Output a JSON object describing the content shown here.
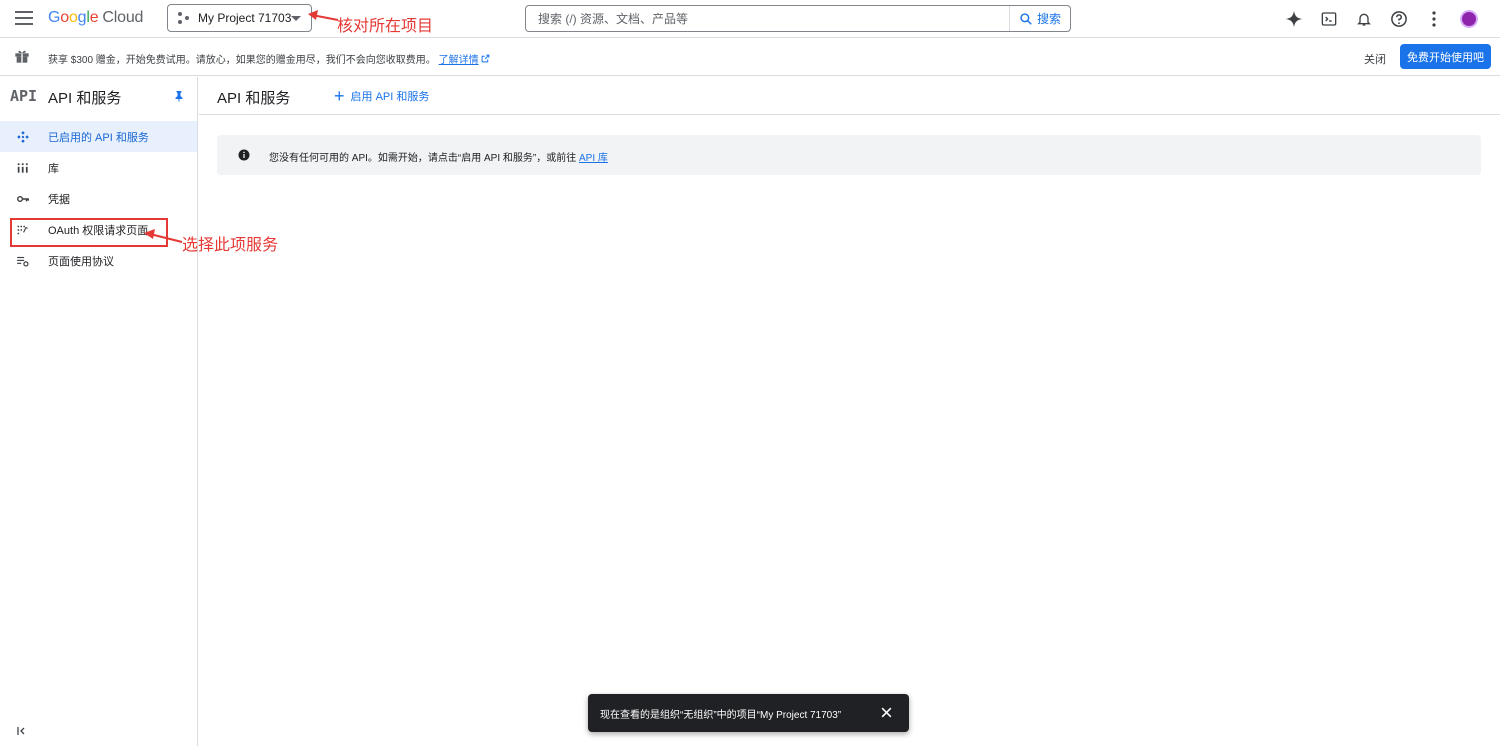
{
  "header": {
    "logo_google": [
      "G",
      "o",
      "o",
      "g",
      "l",
      "e"
    ],
    "logo_cloud": "Cloud",
    "project_name": "My Project 71703",
    "search_placeholder": "搜索 (/) 资源、文档、产品等",
    "search_button": "搜索",
    "icons": [
      "gemini-icon",
      "cloud-shell-icon",
      "notifications-icon",
      "help-icon",
      "more-vert-icon",
      "avatar"
    ]
  },
  "annotations": {
    "project_note": "核对所在项目",
    "oauth_note": "选择此项服务",
    "color": "#e53935"
  },
  "promo": {
    "text": "获享 $300 赠金，开始免费试用。请放心，如果您的赠金用尽，我们不会向您收取费用。",
    "link": "了解详情",
    "close": "关闭",
    "cta": "免费开始使用吧"
  },
  "sidebar": {
    "logo_text": "API",
    "title": "API 和服务",
    "items": [
      {
        "label": "已启用的 API 和服务",
        "icon": "api-hub-icon",
        "active": true
      },
      {
        "label": "库",
        "icon": "library-icon",
        "active": false
      },
      {
        "label": "凭据",
        "icon": "key-icon",
        "active": false
      },
      {
        "label": "OAuth 权限请求页面",
        "icon": "oauth-consent-icon",
        "active": false
      },
      {
        "label": "页面使用协议",
        "icon": "page-usage-icon",
        "active": false
      }
    ]
  },
  "main": {
    "title": "API 和服务",
    "enable_button": "启用 API 和服务",
    "info_text": "您没有任何可用的 API。如需开始，请点击“启用 API 和服务”，或前往",
    "info_link": "API 库"
  },
  "toast": {
    "text": "现在查看的是组织“无组织”中的项目“My Project 71703”"
  },
  "colors": {
    "accent": "#1a73e8",
    "active_bg": "#e8f0fe",
    "toast_bg": "#202124"
  }
}
